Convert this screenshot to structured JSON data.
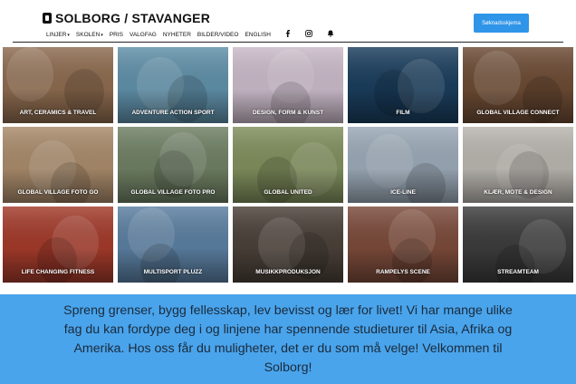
{
  "header": {
    "logo_text": "SOLBORG / STAVANGER",
    "cta_label": "Søknadsskjema",
    "nav": [
      {
        "label": "LINJER",
        "caret": "▾"
      },
      {
        "label": "SKOLEN",
        "caret": "▾"
      },
      {
        "label": "PRIS"
      },
      {
        "label": "VALGFAG"
      },
      {
        "label": "NYHETER"
      },
      {
        "label": "BILDER/VIDEO"
      },
      {
        "label": "ENGLISH"
      }
    ],
    "icons": [
      "facebook-icon",
      "instagram-icon",
      "bell-icon"
    ]
  },
  "tiles": [
    {
      "label": "ART, CERAMICS & TRAVEL",
      "bg": "#8c6a4e"
    },
    {
      "label": "ADVENTURE ACTION SPORT",
      "bg": "#5f8fa8"
    },
    {
      "label": "DESIGN, FORM & KUNST",
      "bg": "#c9b9c8"
    },
    {
      "label": "FILM",
      "bg": "#1a3d5c"
    },
    {
      "label": "GLOBAL VILLAGE CONNECT",
      "bg": "#6b4a33"
    },
    {
      "label": "GLOBAL VILLAGE FOTO GO",
      "bg": "#a88a6a"
    },
    {
      "label": "GLOBAL VILLAGE FOTO PRO",
      "bg": "#6e7f63"
    },
    {
      "label": "GLOBAL UNITED",
      "bg": "#7f8e5c"
    },
    {
      "label": "ICE-LINE",
      "bg": "#9aa8b6"
    },
    {
      "label": "KLÆR, MOTE & DESIGN",
      "bg": "#b8b4ae"
    },
    {
      "label": "LIFE CHANGING FITNESS",
      "bg": "#a23a2a"
    },
    {
      "label": "MULTISPORT PLUZZ",
      "bg": "#5a7ea0"
    },
    {
      "label": "MUSIKKPRODUKSJON",
      "bg": "#4a4038"
    },
    {
      "label": "RAMPELYS SCENE",
      "bg": "#7a4a3a"
    },
    {
      "label": "STREAMTEAM",
      "bg": "#3c3c3c"
    }
  ],
  "banner": {
    "text": "Spreng grenser, bygg fellesskap, lev bevisst og lær for livet!  Vi har mange ulike fag du kan fordype deg i og linjene har spennende studieturer til Asia, Afrika og Amerika. Hos oss får du muligheter, det er du som må velge! Velkommen til Solborg!"
  }
}
